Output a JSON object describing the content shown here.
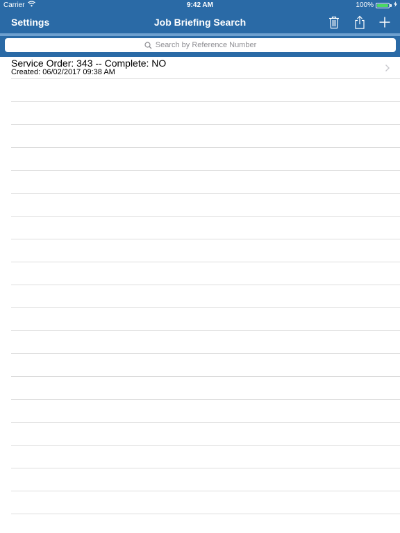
{
  "status_bar": {
    "carrier": "Carrier",
    "time": "9:42 AM",
    "battery_text": "100%",
    "battery_level": 1.0,
    "battery_color": "#4cd964"
  },
  "nav": {
    "back_label": "Settings",
    "title": "Job Briefing Search",
    "icons": [
      "trash-icon",
      "share-icon",
      "plus-icon"
    ]
  },
  "search": {
    "placeholder": "Search by Reference Number",
    "icon": "search-icon"
  },
  "list": {
    "items": [
      {
        "title": "Service Order: 343 -- Complete: NO",
        "subtitle": "Created: 06/02/2017 09:38 AM",
        "icon": "chevron-right-icon"
      }
    ]
  },
  "colors": {
    "nav_background": "#2a6aa6",
    "search_band_border": "#6ea0cf",
    "separator": "#dcdcdc"
  }
}
